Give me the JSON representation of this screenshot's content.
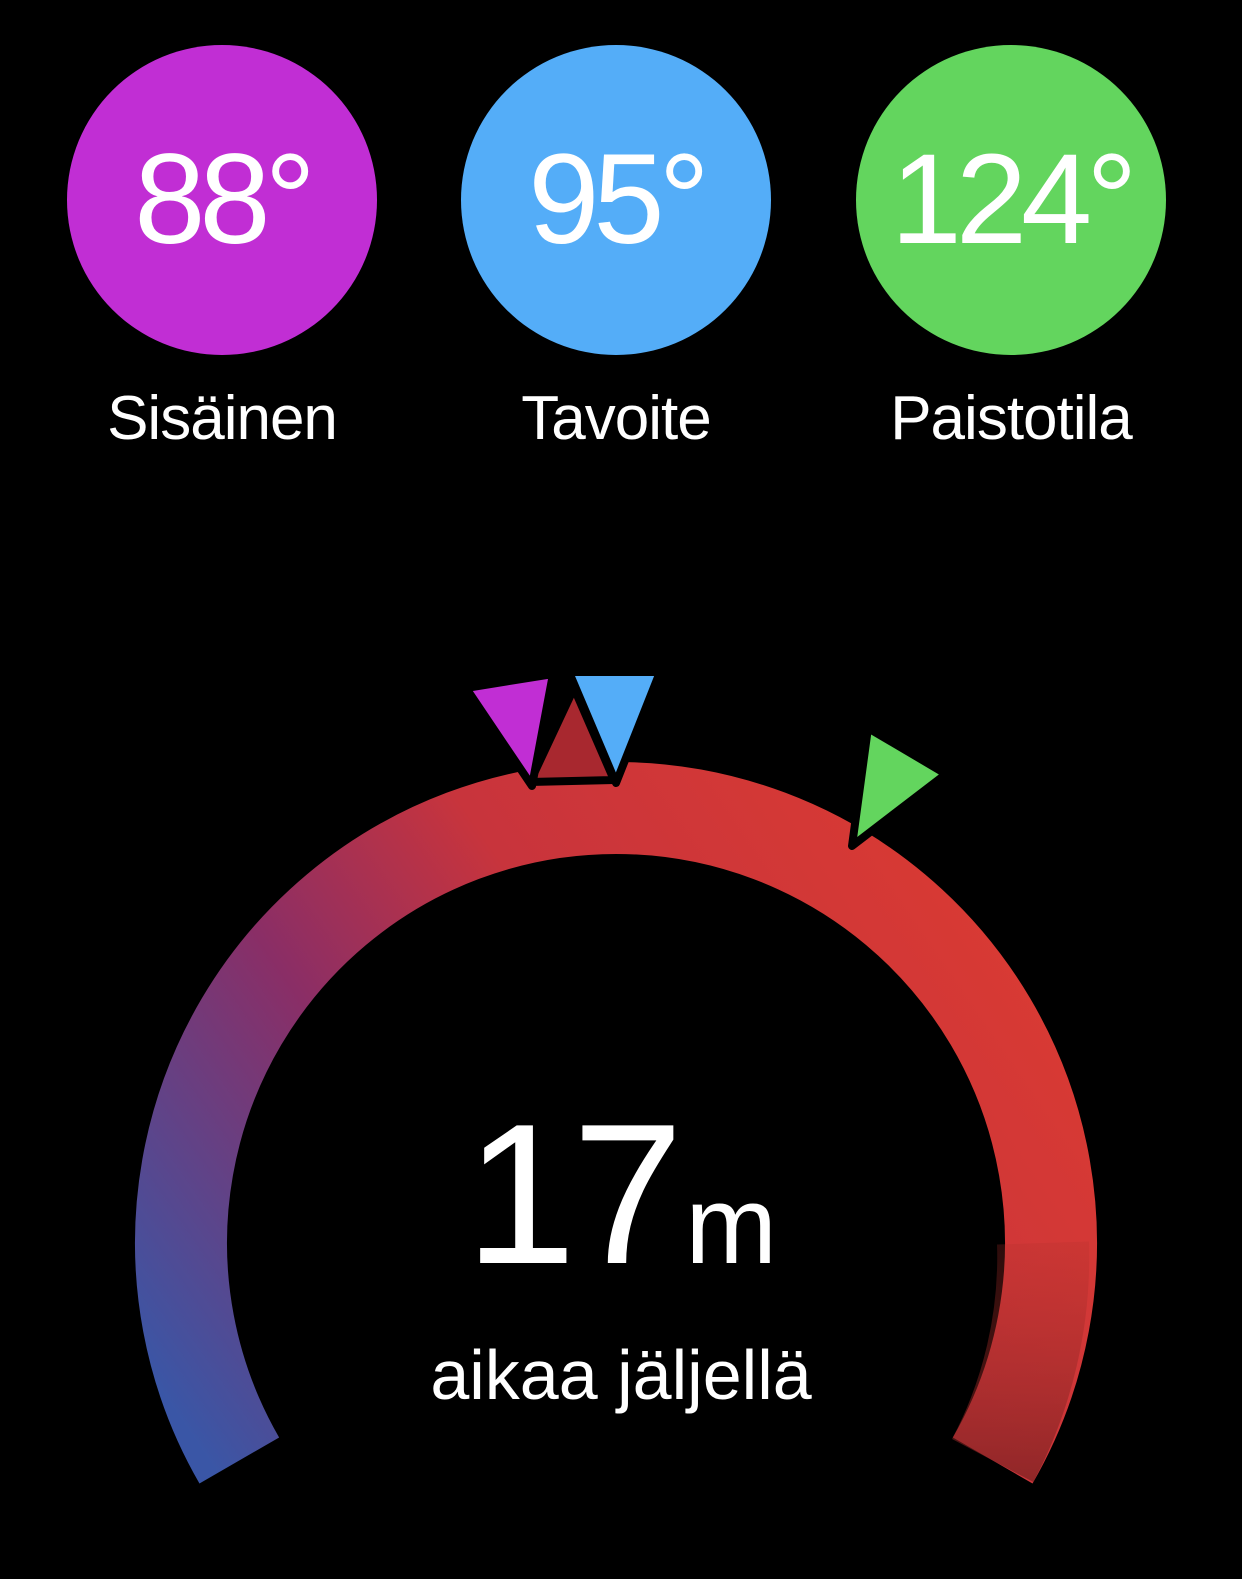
{
  "temps": [
    {
      "id": "internal",
      "value": "88°",
      "label": "Sisäinen",
      "color": "#C12ED4"
    },
    {
      "id": "target",
      "value": "95°",
      "label": "Tavoite",
      "color": "#54ADF8"
    },
    {
      "id": "oven",
      "value": "124°",
      "label": "Paistotila",
      "color": "#63D55E"
    }
  ],
  "gauge": {
    "gradient_start": "#3A56A6",
    "gradient_mid": "#9A2B58",
    "gradient_end": "#D93A33",
    "gradient_tail": "#7F2424"
  },
  "time": {
    "value": "17",
    "unit": "m",
    "label": "aikaa jäljellä"
  }
}
